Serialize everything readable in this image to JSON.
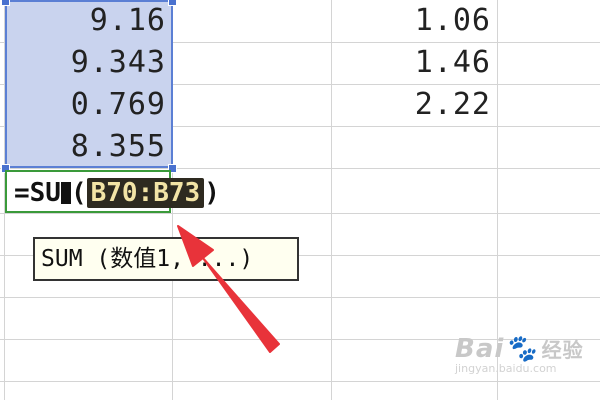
{
  "cells": {
    "col_b": [
      "9.16",
      "9.343",
      "0.769",
      "8.355"
    ],
    "col_e": [
      "1.06",
      "1.46",
      "2.22"
    ]
  },
  "formula": {
    "prefix": "=SU",
    "open_paren": "(",
    "range": "B70:B73",
    "close_paren": ")"
  },
  "tooltip": {
    "text": "SUM (数值1, ...)"
  },
  "watermark": {
    "logo": "Bai",
    "suffix": "经验",
    "url": "jingyan.baidu.com"
  },
  "colors": {
    "selection_fill": "#c9d3ee",
    "selection_border": "#5b7fd4",
    "edit_border": "#3a9a3a",
    "arrow": "#e8333a",
    "tooltip_bg": "#fffff0"
  }
}
